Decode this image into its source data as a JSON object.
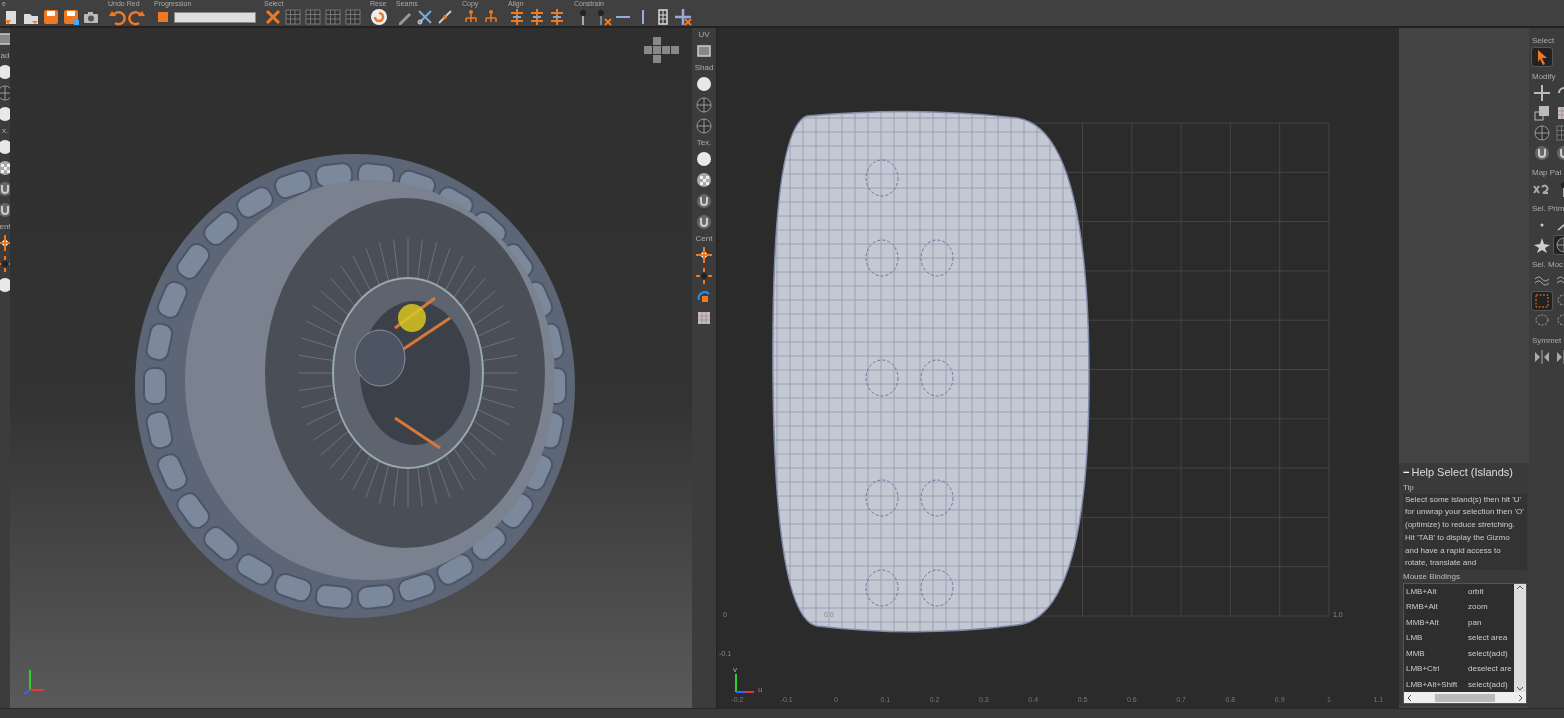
{
  "toolbar": {
    "groups": [
      {
        "label": "e"
      },
      {
        "label": "Undo Red"
      },
      {
        "label": "Progression",
        "level": 1
      },
      {
        "label": "Select"
      },
      {
        "label": "Rese"
      },
      {
        "label": "Seams"
      },
      {
        "label": "Copy"
      },
      {
        "label": "Align"
      },
      {
        "label": "Constrain"
      }
    ]
  },
  "left_strip": {
    "labels": [
      "ad",
      "x.",
      "ent"
    ]
  },
  "mid_strip": {
    "labels": [
      "UV",
      "Shad",
      "Tex.",
      "Cent"
    ]
  },
  "uv_view": {
    "tick_labels": [
      "-0.2",
      "-0.1",
      "0",
      "0.1",
      "0.2",
      "0.3",
      "0.4",
      "0.5",
      "0.6",
      "0.7",
      "0.8",
      "0.9",
      "1",
      "1.1"
    ],
    "corner_labels": [
      "0",
      "0.0",
      "1.0",
      "-0.1"
    ],
    "axis": {
      "v": "v",
      "u": "u"
    }
  },
  "tool_panel": {
    "sections": [
      {
        "label": "Select",
        "tools": [
          {
            "selected": true
          }
        ]
      },
      {
        "label": "Modify",
        "tools": [
          {
            "selected": false
          },
          {
            "selected": false
          },
          {
            "selected": false
          },
          {
            "selected": false
          },
          {
            "selected": false
          },
          {
            "selected": false
          },
          {
            "selected": false
          },
          {
            "selected": false
          }
        ]
      },
      {
        "label": "Map Pai",
        "tools": [
          {
            "selected": false
          },
          {
            "selected": false
          }
        ]
      },
      {
        "label": "Sel. Prim",
        "tools": [
          {
            "selected": false
          },
          {
            "selected": false
          },
          {
            "selected": false
          },
          {
            "selected": true
          }
        ]
      },
      {
        "label": "Sel. Moc",
        "tools": [
          {
            "selected": false
          },
          {
            "selected": false
          },
          {
            "selected": true
          },
          {
            "selected": false
          },
          {
            "selected": false
          },
          {
            "selected": false
          }
        ]
      },
      {
        "label": "Symmet",
        "tools": [
          {
            "selected": false
          },
          {
            "selected": false
          }
        ]
      }
    ]
  },
  "help_panel": {
    "collapse": "−",
    "title": "Help Select (Islands)",
    "tip_label": "Tip",
    "tip": "Select some island(s) then hit 'U' for unwrap your selection then 'O' (optimize) to reduce stretching. Hit 'TAB' to display the Gizmo and have a rapid access to rotate, translate and",
    "bindings_label": "Mouse Bindings",
    "bindings": [
      {
        "keys": "LMB+Alt",
        "action": "orbit"
      },
      {
        "keys": "RMB+Alt",
        "action": "zoom"
      },
      {
        "keys": "MMB+Alt",
        "action": "pan"
      },
      {
        "keys": "LMB",
        "action": "select area"
      },
      {
        "keys": "MMB",
        "action": "select(add)"
      },
      {
        "keys": "LMB+Ctrl",
        "action": "deselect are"
      },
      {
        "keys": "LMB+Alt+Shift",
        "action": "select(add)"
      }
    ]
  }
}
